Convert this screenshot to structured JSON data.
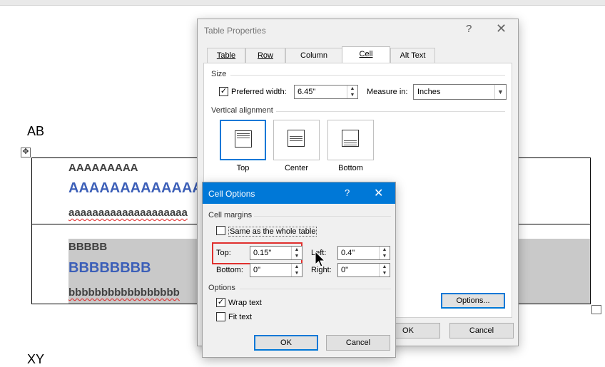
{
  "document": {
    "heading_top": "AB",
    "heading_bottom": "XY",
    "row1": {
      "small": "AAAAAAAAA",
      "big": "AAAAAAAAAAAAA",
      "lower": "aaaaaaaaaaaaaaaaaaaa"
    },
    "row2": {
      "small": "BBBBB",
      "big": "BBBBBBBB",
      "lower": "bbbbbbbbbbbbbbbbb"
    },
    "shade_color": "#c9c9c9",
    "accent_text_color": "#3c5fb8"
  },
  "table_properties": {
    "title": "Table Properties",
    "help": "?",
    "close": "✕",
    "tabs": [
      {
        "label": "Table",
        "active": false
      },
      {
        "label": "Row",
        "active": false
      },
      {
        "label": "Column",
        "active": false
      },
      {
        "label": "Cell",
        "active": true
      },
      {
        "label": "Alt Text",
        "active": false
      }
    ],
    "size_label": "Size",
    "preferred_width_label": "Preferred width:",
    "preferred_width_checked": true,
    "preferred_width_value": "6.45\"",
    "measure_in_label": "Measure in:",
    "measure_in_value": "Inches",
    "vertical_alignment_label": "Vertical alignment",
    "valign_options": [
      {
        "label": "Top",
        "selected": true
      },
      {
        "label": "Center",
        "selected": false
      },
      {
        "label": "Bottom",
        "selected": false
      }
    ],
    "options_button": "Options...",
    "ok_button": "OK",
    "cancel_button": "Cancel"
  },
  "cell_options": {
    "title": "Cell Options",
    "help": "?",
    "close": "✕",
    "cell_margins_label": "Cell margins",
    "same_as_table_label": "Same as the whole table",
    "same_as_table_checked": false,
    "top_label": "Top:",
    "top_value": "0.15\"",
    "left_label": "Left:",
    "left_value": "0.4\"",
    "bottom_label": "Bottom:",
    "bottom_value": "0\"",
    "right_label": "Right:",
    "right_value": "0\"",
    "options_label": "Options",
    "wrap_text_label": "Wrap text",
    "wrap_text_checked": true,
    "fit_text_label": "Fit text",
    "fit_text_checked": false,
    "ok_button": "OK",
    "cancel_button": "Cancel",
    "highlight_color": "#e0302e",
    "titlebar_color": "#0078d7"
  }
}
